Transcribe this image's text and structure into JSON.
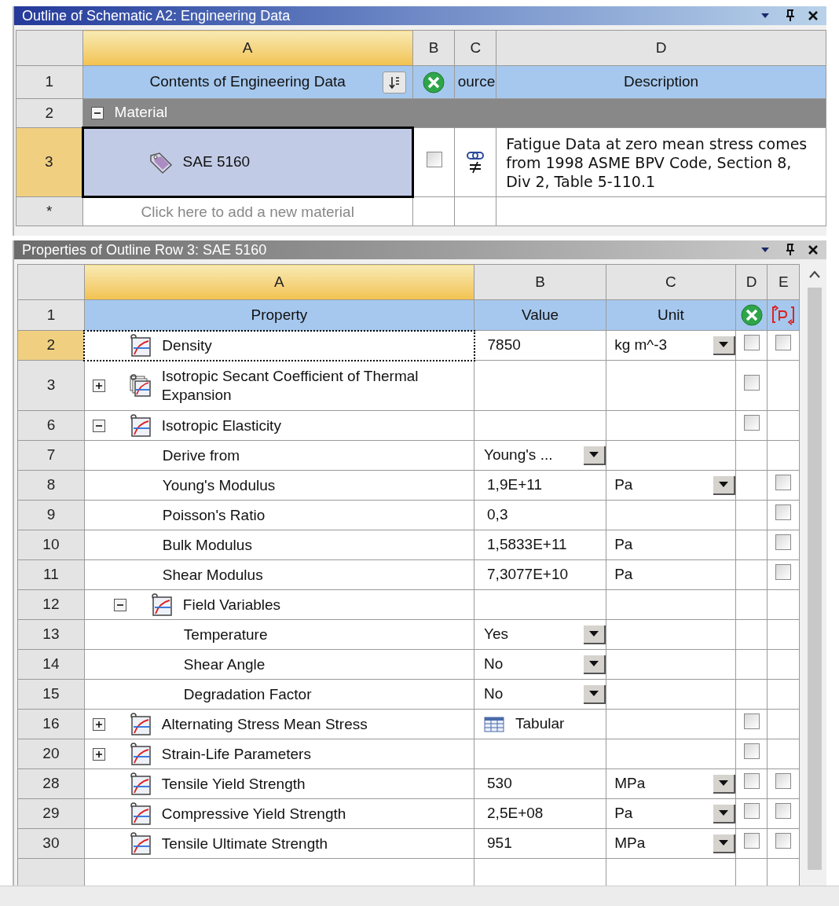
{
  "outline": {
    "title": "Outline of Schematic A2: Engineering Data",
    "active": true,
    "columns": [
      "A",
      "B",
      "C",
      "D"
    ],
    "header": {
      "number": "1",
      "contents": "Contents of Engineering Data",
      "source": "ource",
      "description": "Description"
    },
    "group": {
      "number": "2",
      "label": "Material",
      "expanded": true
    },
    "materials": [
      {
        "number": "3",
        "name": "SAE 5160",
        "selected": true,
        "checked": false,
        "description": "Fatigue Data at zero mean stress comes from 1998 ASME BPV Code, Section 8, Div 2, Table 5-110.1"
      }
    ],
    "add_row": {
      "number": "*",
      "placeholder": "Click here to add a new material"
    }
  },
  "properties": {
    "title": "Properties of Outline Row 3: SAE 5160",
    "active": false,
    "columns": [
      "A",
      "B",
      "C",
      "D",
      "E"
    ],
    "header": {
      "number": "1",
      "property": "Property",
      "value": "Value",
      "unit": "Unit"
    },
    "rows": [
      {
        "number": "2",
        "kind": "single",
        "label": "Density",
        "selected": true,
        "value": {
          "kind": "text",
          "text": "7850"
        },
        "unit": {
          "text": "kg m^-3",
          "dropdown": true
        },
        "d": {
          "checked": false
        },
        "e": {
          "checked": false
        }
      },
      {
        "number": "3",
        "kind": "multi",
        "label": "Isotropic Secant Coefficient of Thermal Expansion",
        "selected": false,
        "expanded": false,
        "d": {
          "checked": false
        }
      },
      {
        "number": "6",
        "kind": "single",
        "label": "Isotropic Elasticity",
        "selected": false,
        "expanded": true,
        "d": {
          "checked": false
        },
        "children": [
          {
            "number": "7",
            "kind": "plain",
            "label": "Derive from",
            "selected": false,
            "value": {
              "kind": "dropdown",
              "text": "Young's ..."
            }
          },
          {
            "number": "8",
            "kind": "plain",
            "label": "Young's Modulus",
            "selected": false,
            "value": {
              "kind": "text",
              "text": "1,9E+11"
            },
            "unit": {
              "text": "Pa",
              "dropdown": true
            },
            "e": {
              "checked": false
            }
          },
          {
            "number": "9",
            "kind": "plain",
            "label": "Poisson's Ratio",
            "selected": false,
            "value": {
              "kind": "text",
              "text": "0,3"
            },
            "e": {
              "checked": false
            }
          },
          {
            "number": "10",
            "kind": "plain",
            "label": "Bulk Modulus",
            "selected": false,
            "value": {
              "kind": "text",
              "text": "1,5833E+11"
            },
            "unit": {
              "text": "Pa",
              "dropdown": false
            },
            "e": {
              "checked": false
            }
          },
          {
            "number": "11",
            "kind": "plain",
            "label": "Shear Modulus",
            "selected": false,
            "value": {
              "kind": "text",
              "text": "7,3077E+10"
            },
            "unit": {
              "text": "Pa",
              "dropdown": false
            },
            "e": {
              "checked": false
            }
          },
          {
            "number": "12",
            "kind": "single",
            "label": "Field Variables",
            "selected": false,
            "expanded": true,
            "children": [
              {
                "number": "13",
                "kind": "plain",
                "label": "Temperature",
                "selected": false,
                "value": {
                  "kind": "dropdown",
                  "text": "Yes"
                }
              },
              {
                "number": "14",
                "kind": "plain",
                "label": "Shear Angle",
                "selected": false,
                "value": {
                  "kind": "dropdown",
                  "text": "No"
                }
              },
              {
                "number": "15",
                "kind": "plain",
                "label": "Degradation Factor",
                "selected": false,
                "value": {
                  "kind": "dropdown",
                  "text": "No"
                }
              }
            ]
          }
        ]
      },
      {
        "number": "16",
        "kind": "single",
        "label": "Alternating Stress Mean Stress",
        "selected": false,
        "expanded": false,
        "value": {
          "kind": "tabular",
          "text": "Tabular"
        },
        "d": {
          "checked": false
        }
      },
      {
        "number": "20",
        "kind": "single",
        "label": "Strain-Life Parameters",
        "selected": false,
        "expanded": false,
        "d": {
          "checked": false
        }
      },
      {
        "number": "28",
        "kind": "single",
        "label": "Tensile Yield Strength",
        "selected": false,
        "value": {
          "kind": "text",
          "text": "530"
        },
        "unit": {
          "text": "MPa",
          "dropdown": true
        },
        "d": {
          "checked": false
        },
        "e": {
          "checked": false
        }
      },
      {
        "number": "29",
        "kind": "single",
        "label": "Compressive Yield Strength",
        "selected": false,
        "value": {
          "kind": "text",
          "text": "2,5E+08"
        },
        "unit": {
          "text": "Pa",
          "dropdown": true
        },
        "d": {
          "checked": false
        },
        "e": {
          "checked": false
        }
      },
      {
        "number": "30",
        "kind": "single",
        "label": "Tensile Ultimate Strength",
        "selected": false,
        "value": {
          "kind": "text",
          "text": "951"
        },
        "unit": {
          "text": "MPa",
          "dropdown": true
        },
        "d": {
          "checked": false
        },
        "e": {
          "checked": false
        }
      }
    ]
  }
}
